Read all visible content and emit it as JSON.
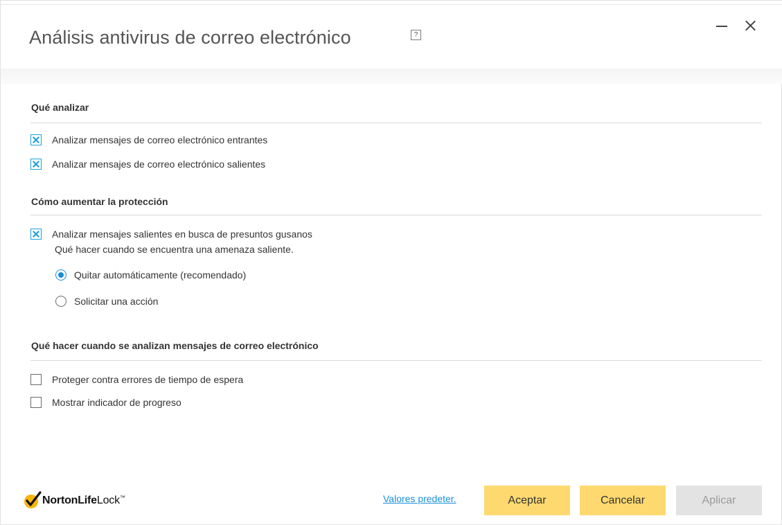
{
  "window": {
    "title": "Análisis antivirus de correo electrónico",
    "help_icon": "?",
    "minimize_icon": "minimize-icon",
    "close_icon": "close-icon"
  },
  "sections": [
    {
      "title": "Qué analizar",
      "options": [
        {
          "label": "Analizar mensajes de correo electrónico entrantes",
          "checked": true
        },
        {
          "label": "Analizar mensajes de correo electrónico salientes",
          "checked": true
        }
      ]
    },
    {
      "title": "Cómo aumentar la protección",
      "options": [
        {
          "label": "Analizar mensajes salientes en busca de presuntos gusanos",
          "checked": true
        }
      ],
      "sub_label": "Qué hacer cuando se encuentra una amenaza saliente.",
      "radios": [
        {
          "label": "Quitar automáticamente (recomendado)",
          "selected": true
        },
        {
          "label": "Solicitar una acción",
          "selected": false
        }
      ]
    },
    {
      "title": "Qué hacer cuando se analizan mensajes de correo electrónico",
      "options": [
        {
          "label": "Proteger contra errores de tiempo de espera",
          "checked": false
        },
        {
          "label": "Mostrar indicador de progreso",
          "checked": false
        }
      ]
    }
  ],
  "footer": {
    "logo": {
      "part1": "Norton",
      "part2": "Life",
      "part3": "Lock",
      "tm": "™"
    },
    "defaults_link": "Valores predeter.",
    "accept_label": "Aceptar",
    "cancel_label": "Cancelar",
    "apply_label": "Aplicar"
  },
  "colors": {
    "accent": "#1aa0d8",
    "button_primary": "#fdd96f",
    "button_disabled": "#e3e3e3",
    "logo_check": "#f5b50a"
  }
}
